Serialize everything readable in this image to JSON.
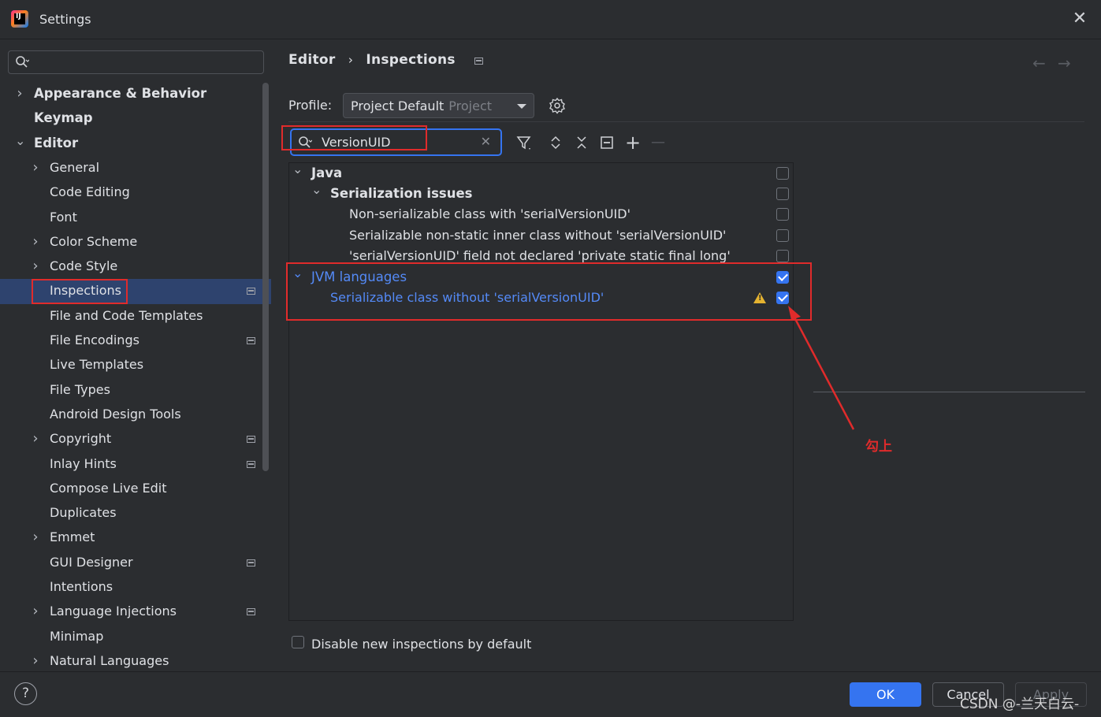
{
  "window": {
    "title": "Settings",
    "close_glyph": "✕"
  },
  "sidebar": {
    "search_placeholder": "",
    "items": [
      {
        "label": "Appearance & Behavior",
        "level": 0,
        "expandable": true,
        "expanded": false,
        "bold": true
      },
      {
        "label": "Keymap",
        "level": 0,
        "expandable": false,
        "bold": true
      },
      {
        "label": "Editor",
        "level": 0,
        "expandable": true,
        "expanded": true,
        "bold": true
      },
      {
        "label": "General",
        "level": 1,
        "expandable": true
      },
      {
        "label": "Code Editing",
        "level": 1
      },
      {
        "label": "Font",
        "level": 1
      },
      {
        "label": "Color Scheme",
        "level": 1,
        "expandable": true
      },
      {
        "label": "Code Style",
        "level": 1,
        "expandable": true
      },
      {
        "label": "Inspections",
        "level": 1,
        "selected": true,
        "project_icon": true
      },
      {
        "label": "File and Code Templates",
        "level": 1
      },
      {
        "label": "File Encodings",
        "level": 1,
        "project_icon": true
      },
      {
        "label": "Live Templates",
        "level": 1
      },
      {
        "label": "File Types",
        "level": 1
      },
      {
        "label": "Android Design Tools",
        "level": 1
      },
      {
        "label": "Copyright",
        "level": 1,
        "expandable": true,
        "project_icon": true
      },
      {
        "label": "Inlay Hints",
        "level": 1,
        "project_icon": true
      },
      {
        "label": "Compose Live Edit",
        "level": 1
      },
      {
        "label": "Duplicates",
        "level": 1
      },
      {
        "label": "Emmet",
        "level": 1,
        "expandable": true
      },
      {
        "label": "GUI Designer",
        "level": 1,
        "project_icon": true
      },
      {
        "label": "Intentions",
        "level": 1
      },
      {
        "label": "Language Injections",
        "level": 1,
        "expandable": true,
        "project_icon": true
      },
      {
        "label": "Minimap",
        "level": 1
      },
      {
        "label": "Natural Languages",
        "level": 1,
        "expandable": true
      }
    ]
  },
  "breadcrumb": {
    "parent": "Editor",
    "separator": "›",
    "current": "Inspections"
  },
  "nav": {
    "back": "←",
    "forward": "→"
  },
  "profile": {
    "label": "Profile:",
    "value": "Project Default",
    "scope": "Project"
  },
  "filter": {
    "value": "VersionUID",
    "clear_glyph": "✕"
  },
  "toolbar": {
    "add": "+",
    "remove": "—"
  },
  "inspections": {
    "rows": [
      {
        "label": "Java",
        "level": 0,
        "group": true,
        "expanded": true,
        "checked": false
      },
      {
        "label": "Serialization issues",
        "level": 1,
        "group": true,
        "expanded": true,
        "checked": false
      },
      {
        "label": "Non-serializable class with 'serialVersionUID'",
        "level": 2,
        "checked": false
      },
      {
        "label": "Serializable non-static inner class without 'serialVersionUID'",
        "level": 2,
        "checked": false
      },
      {
        "label": "'serialVersionUID' field not declared 'private static final long'",
        "level": 2,
        "checked": false
      },
      {
        "label": "JVM languages",
        "level": 0,
        "group": true,
        "expanded": true,
        "checked": true,
        "highlighted": true
      },
      {
        "label": "Serializable class without 'serialVersionUID'",
        "level": 1,
        "checked": true,
        "highlighted": true,
        "severity": "warning"
      }
    ]
  },
  "disable_new": {
    "label": "Disable new inspections by default",
    "checked": false
  },
  "annotation": {
    "text": "勾上"
  },
  "buttons": {
    "help": "?",
    "ok": "OK",
    "cancel": "Cancel",
    "apply": "Apply"
  },
  "watermark": "CSDN @-兰天白云-",
  "colors": {
    "accent": "#3574f0",
    "selection": "#2e436e",
    "annotation_red": "#e02b2b",
    "link_blue": "#548af7",
    "warning": "#e5b330"
  }
}
